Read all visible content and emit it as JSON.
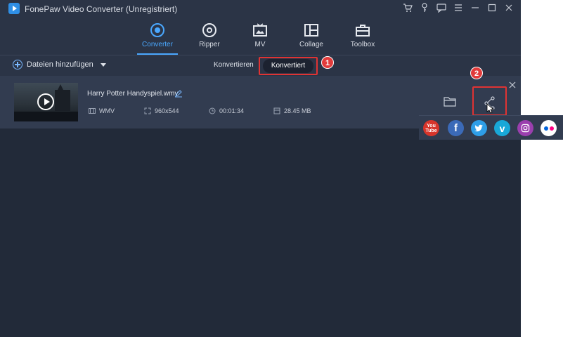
{
  "app": {
    "title": "FonePaw Video Converter (Unregistriert)"
  },
  "nav": {
    "tabs": [
      {
        "label": "Converter",
        "icon": "converter-icon",
        "active": true
      },
      {
        "label": "Ripper",
        "icon": "disc-icon",
        "active": false
      },
      {
        "label": "MV",
        "icon": "mv-icon",
        "active": false
      },
      {
        "label": "Collage",
        "icon": "collage-icon",
        "active": false
      },
      {
        "label": "Toolbox",
        "icon": "toolbox-icon",
        "active": false
      }
    ]
  },
  "toolbar": {
    "add_files_label": "Dateien hinzufügen",
    "sub_tabs": [
      {
        "label": "Konvertieren",
        "active": false
      },
      {
        "label": "Konvertiert",
        "active": true
      }
    ]
  },
  "annotations": {
    "badge_1": "1",
    "badge_2": "2",
    "highlight_color": "#e03333"
  },
  "file": {
    "name": "Harry Potter Handyspiel.wmv",
    "format": "WMV",
    "resolution": "960x544",
    "duration": "00:01:34",
    "size": "28.45 MB"
  },
  "share": {
    "platforms": [
      {
        "name": "YouTube",
        "label_top": "You",
        "label_bottom": "Tube",
        "color": "#d7352b"
      },
      {
        "name": "Facebook",
        "label": "f",
        "color": "#3b6ab8"
      },
      {
        "name": "Twitter",
        "label": "",
        "color": "#2e9ee8"
      },
      {
        "name": "Vimeo",
        "label": "v",
        "color": "#19a8d8"
      },
      {
        "name": "Instagram",
        "label": "",
        "color": "#9b3fae"
      },
      {
        "name": "Flickr",
        "label": "",
        "color": "#ffffff"
      }
    ]
  },
  "colors": {
    "accent": "#4aa8ff",
    "background": "#222a39",
    "panel": "#2b3446",
    "row": "#323c50"
  }
}
